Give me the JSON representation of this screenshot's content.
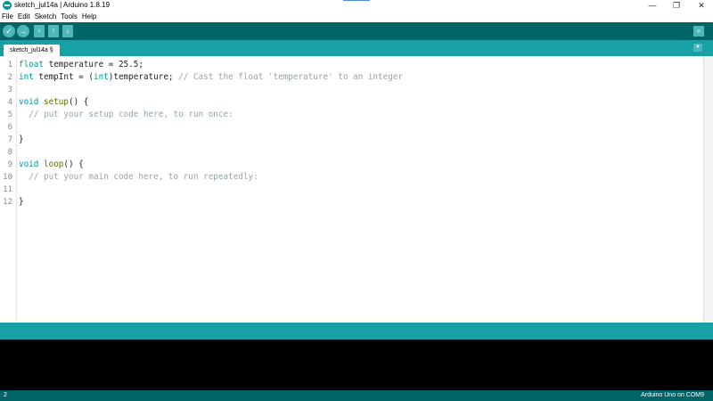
{
  "window": {
    "title": "sketch_jul14a | Arduino 1.8.19",
    "minimize_glyph": "—",
    "maximize_glyph": "❐",
    "close_glyph": "✕"
  },
  "menu": [
    "File",
    "Edit",
    "Sketch",
    "Tools",
    "Help"
  ],
  "toolbar": {
    "verify_glyph": "✓",
    "upload_glyph": "→",
    "new_glyph": "▫",
    "open_glyph": "↑",
    "save_glyph": "↓",
    "serial_glyph": "⌕"
  },
  "tabs": [
    {
      "label": "sketch_jul14a §"
    }
  ],
  "tab_menu_glyph": "▼",
  "editor": {
    "line_numbers": [
      "1",
      "2",
      "3",
      "4",
      "5",
      "6",
      "7",
      "8",
      "9",
      "10",
      "11",
      "12"
    ],
    "lines": [
      [
        {
          "t": "float",
          "c": "kw-type"
        },
        {
          "t": " temperature = 25.5;",
          "c": ""
        }
      ],
      [
        {
          "t": "int",
          "c": "kw-type"
        },
        {
          "t": " tempInt = (",
          "c": ""
        },
        {
          "t": "int",
          "c": "kw-type"
        },
        {
          "t": ")temperature; ",
          "c": ""
        },
        {
          "t": "// Cast the float 'temperature' to an integer",
          "c": "cmt"
        }
      ],
      [],
      [
        {
          "t": "void",
          "c": "kw-type"
        },
        {
          "t": " ",
          "c": ""
        },
        {
          "t": "setup",
          "c": "kw-fn"
        },
        {
          "t": "() {",
          "c": ""
        }
      ],
      [
        {
          "t": "  // put your setup code here, to run once:",
          "c": "cmt"
        }
      ],
      [],
      [
        {
          "t": "}",
          "c": ""
        }
      ],
      [],
      [
        {
          "t": "void",
          "c": "kw-type"
        },
        {
          "t": " ",
          "c": ""
        },
        {
          "t": "loop",
          "c": "kw-fn"
        },
        {
          "t": "() {",
          "c": ""
        }
      ],
      [
        {
          "t": "  // put your main code here, to run repeatedly:",
          "c": "cmt"
        }
      ],
      [],
      [
        {
          "t": "}",
          "c": ""
        }
      ]
    ]
  },
  "status": {
    "line": "2",
    "board": "Arduino Uno on COM9"
  },
  "colors": {
    "toolbar": "#006468",
    "tabbar": "#17a1a5",
    "console": "#000000",
    "keyword": "#00979c",
    "function": "#5e6d03",
    "comment": "#95a5a6"
  }
}
